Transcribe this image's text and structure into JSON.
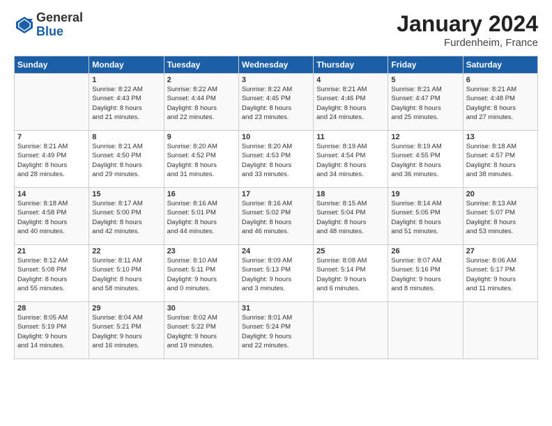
{
  "header": {
    "logo_general": "General",
    "logo_blue": "Blue",
    "month_title": "January 2024",
    "location": "Furdenheim, France"
  },
  "days_of_week": [
    "Sunday",
    "Monday",
    "Tuesday",
    "Wednesday",
    "Thursday",
    "Friday",
    "Saturday"
  ],
  "weeks": [
    [
      {
        "day": "",
        "info": ""
      },
      {
        "day": "1",
        "info": "Sunrise: 8:22 AM\nSunset: 4:43 PM\nDaylight: 8 hours\nand 21 minutes."
      },
      {
        "day": "2",
        "info": "Sunrise: 8:22 AM\nSunset: 4:44 PM\nDaylight: 8 hours\nand 22 minutes."
      },
      {
        "day": "3",
        "info": "Sunrise: 8:22 AM\nSunset: 4:45 PM\nDaylight: 8 hours\nand 23 minutes."
      },
      {
        "day": "4",
        "info": "Sunrise: 8:21 AM\nSunset: 4:46 PM\nDaylight: 8 hours\nand 24 minutes."
      },
      {
        "day": "5",
        "info": "Sunrise: 8:21 AM\nSunset: 4:47 PM\nDaylight: 8 hours\nand 25 minutes."
      },
      {
        "day": "6",
        "info": "Sunrise: 8:21 AM\nSunset: 4:48 PM\nDaylight: 8 hours\nand 27 minutes."
      }
    ],
    [
      {
        "day": "7",
        "info": "Sunrise: 8:21 AM\nSunset: 4:49 PM\nDaylight: 8 hours\nand 28 minutes."
      },
      {
        "day": "8",
        "info": "Sunrise: 8:21 AM\nSunset: 4:50 PM\nDaylight: 8 hours\nand 29 minutes."
      },
      {
        "day": "9",
        "info": "Sunrise: 8:20 AM\nSunset: 4:52 PM\nDaylight: 8 hours\nand 31 minutes."
      },
      {
        "day": "10",
        "info": "Sunrise: 8:20 AM\nSunset: 4:53 PM\nDaylight: 8 hours\nand 33 minutes."
      },
      {
        "day": "11",
        "info": "Sunrise: 8:19 AM\nSunset: 4:54 PM\nDaylight: 8 hours\nand 34 minutes."
      },
      {
        "day": "12",
        "info": "Sunrise: 8:19 AM\nSunset: 4:55 PM\nDaylight: 8 hours\nand 36 minutes."
      },
      {
        "day": "13",
        "info": "Sunrise: 8:18 AM\nSunset: 4:57 PM\nDaylight: 8 hours\nand 38 minutes."
      }
    ],
    [
      {
        "day": "14",
        "info": "Sunrise: 8:18 AM\nSunset: 4:58 PM\nDaylight: 8 hours\nand 40 minutes."
      },
      {
        "day": "15",
        "info": "Sunrise: 8:17 AM\nSunset: 5:00 PM\nDaylight: 8 hours\nand 42 minutes."
      },
      {
        "day": "16",
        "info": "Sunrise: 8:16 AM\nSunset: 5:01 PM\nDaylight: 8 hours\nand 44 minutes."
      },
      {
        "day": "17",
        "info": "Sunrise: 8:16 AM\nSunset: 5:02 PM\nDaylight: 8 hours\nand 46 minutes."
      },
      {
        "day": "18",
        "info": "Sunrise: 8:15 AM\nSunset: 5:04 PM\nDaylight: 8 hours\nand 48 minutes."
      },
      {
        "day": "19",
        "info": "Sunrise: 8:14 AM\nSunset: 5:05 PM\nDaylight: 8 hours\nand 51 minutes."
      },
      {
        "day": "20",
        "info": "Sunrise: 8:13 AM\nSunset: 5:07 PM\nDaylight: 8 hours\nand 53 minutes."
      }
    ],
    [
      {
        "day": "21",
        "info": "Sunrise: 8:12 AM\nSunset: 5:08 PM\nDaylight: 8 hours\nand 55 minutes."
      },
      {
        "day": "22",
        "info": "Sunrise: 8:11 AM\nSunset: 5:10 PM\nDaylight: 8 hours\nand 58 minutes."
      },
      {
        "day": "23",
        "info": "Sunrise: 8:10 AM\nSunset: 5:11 PM\nDaylight: 9 hours\nand 0 minutes."
      },
      {
        "day": "24",
        "info": "Sunrise: 8:09 AM\nSunset: 5:13 PM\nDaylight: 9 hours\nand 3 minutes."
      },
      {
        "day": "25",
        "info": "Sunrise: 8:08 AM\nSunset: 5:14 PM\nDaylight: 9 hours\nand 6 minutes."
      },
      {
        "day": "26",
        "info": "Sunrise: 8:07 AM\nSunset: 5:16 PM\nDaylight: 9 hours\nand 8 minutes."
      },
      {
        "day": "27",
        "info": "Sunrise: 8:06 AM\nSunset: 5:17 PM\nDaylight: 9 hours\nand 11 minutes."
      }
    ],
    [
      {
        "day": "28",
        "info": "Sunrise: 8:05 AM\nSunset: 5:19 PM\nDaylight: 9 hours\nand 14 minutes."
      },
      {
        "day": "29",
        "info": "Sunrise: 8:04 AM\nSunset: 5:21 PM\nDaylight: 9 hours\nand 16 minutes."
      },
      {
        "day": "30",
        "info": "Sunrise: 8:02 AM\nSunset: 5:22 PM\nDaylight: 9 hours\nand 19 minutes."
      },
      {
        "day": "31",
        "info": "Sunrise: 8:01 AM\nSunset: 5:24 PM\nDaylight: 9 hours\nand 22 minutes."
      },
      {
        "day": "",
        "info": ""
      },
      {
        "day": "",
        "info": ""
      },
      {
        "day": "",
        "info": ""
      }
    ]
  ]
}
